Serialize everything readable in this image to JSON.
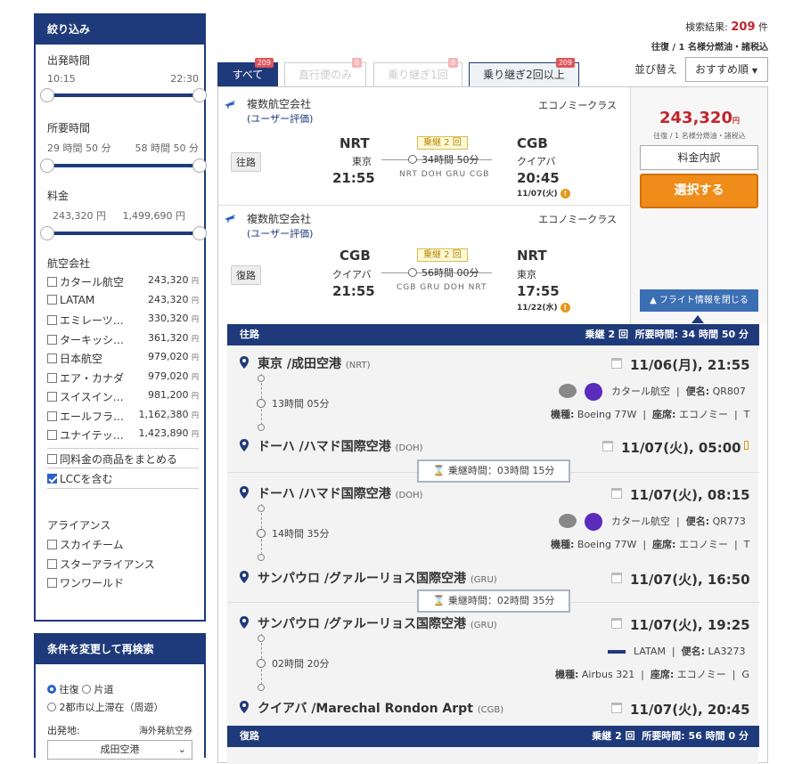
{
  "sidebar": {
    "title": "絞り込み",
    "departure": {
      "label": "出発時間",
      "min": "10:15",
      "max": "22:30"
    },
    "duration": {
      "label": "所要時間",
      "min": "29 時間 50 分",
      "max": "58 時間 50 分"
    },
    "price": {
      "label": "料金",
      "min": "243,320 円",
      "max": "1,499,690 円"
    },
    "airlines_label": "航空会社",
    "yen": "円",
    "airlines": [
      {
        "name": "カタール航空",
        "price": "243,320"
      },
      {
        "name": "LATAM",
        "price": "243,320"
      },
      {
        "name": "エミレーツ…",
        "price": "330,320"
      },
      {
        "name": "ターキッシ…",
        "price": "361,320"
      },
      {
        "name": "日本航空",
        "price": "979,020"
      },
      {
        "name": "エア・カナダ",
        "price": "979,020"
      },
      {
        "name": "スイスイン…",
        "price": "981,200"
      },
      {
        "name": "エールフラ…",
        "price": "1,162,380"
      },
      {
        "name": "ユナイテッ…",
        "price": "1,423,890"
      }
    ],
    "same_price": "同料金の商品をまとめる",
    "lcc": "LCCを含む",
    "alliance_label": "アライアンス",
    "alliances": [
      "スカイチーム",
      "スターアライアンス",
      "ワンワールド"
    ]
  },
  "research": {
    "title": "条件を変更して再検索",
    "roundtrip": "往復",
    "oneway": "片道",
    "multi": "2都市以上滞在（周遊）",
    "dep_label": "出発地:",
    "overseas": "海外発航空券",
    "dep_value": "成田空港"
  },
  "results": {
    "label": "検索結果:",
    "count": "209",
    "unit": "件",
    "note": "往復 / 1 名様分燃油・諸税込"
  },
  "sort": {
    "label": "並び替え",
    "value": "おすすめ順"
  },
  "tabs": [
    {
      "label": "すべて",
      "badge": "209"
    },
    {
      "label": "直行便のみ",
      "badge": "0"
    },
    {
      "label": "乗り継ぎ1回",
      "badge": "0"
    },
    {
      "label": "乗り継ぎ2回以上",
      "badge": "209"
    }
  ],
  "outbound": {
    "carrier": "複数航空会社",
    "rating": "(ユーザー評価)",
    "class": "エコノミークラス",
    "dir": "往路",
    "from_code": "NRT",
    "from_city": "東京",
    "dep_time": "21:55",
    "stops": "乗継 2 回",
    "duration": "34時間 50分",
    "via": "NRT  DOH  GRU  CGB",
    "to_code": "CGB",
    "to_city": "クイアバ",
    "arr_time": "20:45",
    "arr_date": "11/07(火)"
  },
  "inbound": {
    "carrier": "複数航空会社",
    "rating": "(ユーザー評価)",
    "class": "エコノミークラス",
    "dir": "復路",
    "from_code": "CGB",
    "from_city": "クイアバ",
    "dep_time": "21:55",
    "stops": "乗継 2 回",
    "duration": "56時間 00分",
    "via": "CGB  GRU  DOH  NRT",
    "to_code": "NRT",
    "to_city": "東京",
    "arr_time": "17:55",
    "arr_date": "11/22(水)"
  },
  "price": {
    "amount": "243,320",
    "unit": "円",
    "note": "往復 / 1 名様分燃油・諸税込",
    "breakdown": "料金内訳",
    "select": "選択する",
    "close": "▲ フライト情報を閉じる"
  },
  "detail": {
    "out_head": "往路",
    "out_stops": "乗継 2 回",
    "dur_label": "所要時間:",
    "out_dur": "34 時間 50 分",
    "seg1": {
      "from": "東京 /成田空港",
      "from_code": "(NRT)",
      "dep": "11/06(月), 21:55",
      "flight_dur": "13時間 05分",
      "airline": "カタール航空",
      "flight_no_label": "便名:",
      "flight_no": "QR807",
      "aircraft_label": "機種:",
      "aircraft": "Boeing 77W",
      "seat_label": "座席:",
      "seat": "エコノミー",
      "seat_code": "T",
      "to": "ドーハ /ハマド国際空港",
      "to_code": "(DOH)",
      "arr": "11/07(火), 05:00"
    },
    "lay1": "乗継時間：03時間 15分",
    "seg2": {
      "from": "ドーハ /ハマド国際空港",
      "from_code": "(DOH)",
      "dep": "11/07(火), 08:15",
      "flight_dur": "14時間 35分",
      "airline": "カタール航空",
      "flight_no": "QR773",
      "aircraft": "Boeing 77W",
      "seat": "エコノミー",
      "seat_code": "T",
      "to": "サンパウロ /グァルーリョス国際空港",
      "to_code": "(GRU)",
      "arr": "11/07(火), 16:50"
    },
    "lay2": "乗継時間：02時間 35分",
    "seg3": {
      "from": "サンパウロ /グァルーリョス国際空港",
      "from_code": "(GRU)",
      "dep": "11/07(火), 19:25",
      "flight_dur": "02時間 20分",
      "airline": "LATAM",
      "flight_no": "LA3273",
      "aircraft": "Airbus 321",
      "seat": "エコノミー",
      "seat_code": "G",
      "to": "クイアバ /Marechal Rondon Arpt",
      "to_code": "(CGB)",
      "arr": "11/07(火), 20:45"
    },
    "in_head": "復路",
    "in_stops": "乗継 2 回",
    "in_dur": "56 時間 0 分"
  }
}
